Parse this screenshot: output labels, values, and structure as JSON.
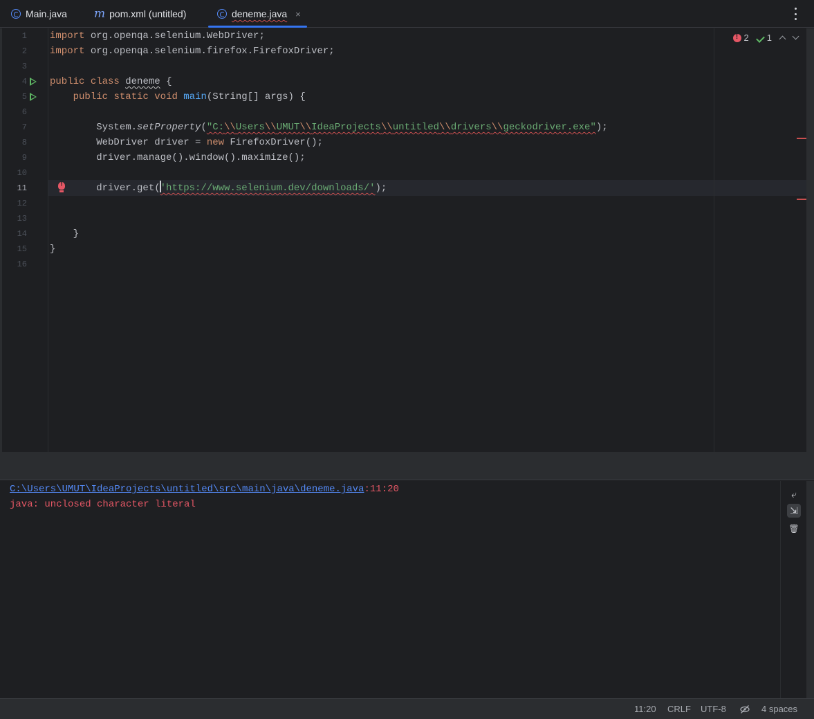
{
  "tabs": [
    {
      "label": "Main.java",
      "icon": "java-class-icon"
    },
    {
      "label": "pom.xml (untitled)",
      "icon": "maven-icon",
      "icon_glyph": "m"
    },
    {
      "label": "deneme.java",
      "icon": "java-class-icon",
      "close": "×"
    }
  ],
  "editor": {
    "line_numbers": [
      "1",
      "2",
      "3",
      "4",
      "5",
      "6",
      "7",
      "8",
      "9",
      "10",
      "11",
      "12",
      "13",
      "14",
      "15",
      "16"
    ],
    "lines": {
      "l1": {
        "kw": "import",
        "rest": " org.openqa.selenium.WebDriver;"
      },
      "l2": {
        "kw": "import",
        "rest": " org.openqa.selenium.firefox.FirefoxDriver;"
      },
      "l4": {
        "kw1": "public",
        "kw2": "class",
        "name": "deneme",
        "rest": " {"
      },
      "l5": {
        "indent": "    ",
        "kw1": "public",
        "kw2": "static",
        "kw3": "void",
        "fn": "main",
        "rest": "(String[] args) {"
      },
      "l7": {
        "indent": "        ",
        "obj": "System.",
        "method": "setProperty",
        "open": "(",
        "s1": "\"C:",
        "e1": "\\\\",
        "s2": "Users",
        "e2": "\\\\",
        "s3": "UMUT",
        "e3": "\\\\",
        "s4": "IdeaProjects",
        "e4": "\\\\",
        "s5": "untitled",
        "e5": "\\\\",
        "s6": "drivers",
        "e6": "\\\\",
        "s7": "geckodriver.exe\"",
        "close": ");"
      },
      "l8": {
        "indent": "        ",
        "a": "WebDriver driver = ",
        "kw": "new",
        "b": " FirefoxDriver();"
      },
      "l9": {
        "indent": "        ",
        "a": "driver.manage().window().maximize();"
      },
      "l11": {
        "indent": "        ",
        "a": "driver.get(",
        "str": "'https://www.selenium.dev/downloads/'",
        "b": ");"
      },
      "l14": {
        "indent": "    ",
        "a": "}"
      },
      "l15": {
        "a": "}"
      }
    },
    "current_line": "11"
  },
  "inspections": {
    "errors": "2",
    "weak_warnings": "1"
  },
  "output": {
    "path": "C:\\Users\\UMUT\\IdeaProjects\\untitled\\src\\main\\java\\deneme.java",
    "position": ":11:20",
    "message": "java: unclosed character literal"
  },
  "output_tools": [
    {
      "name": "soft-wrap-icon",
      "glyph": "⤶"
    },
    {
      "name": "scroll-to-end-icon",
      "glyph": "⇲"
    },
    {
      "name": "clear-all-icon",
      "glyph": "🗑"
    }
  ],
  "status": {
    "caret": "11:20",
    "line_separator": "CRLF",
    "encoding": "UTF-8",
    "indent": "4 spaces"
  },
  "colors": {
    "background": "#1e1f22",
    "keyword": "#cf8e6d",
    "string": "#6aab73",
    "function": "#56a8f5",
    "error": "#e55765",
    "accent": "#3574f0"
  }
}
